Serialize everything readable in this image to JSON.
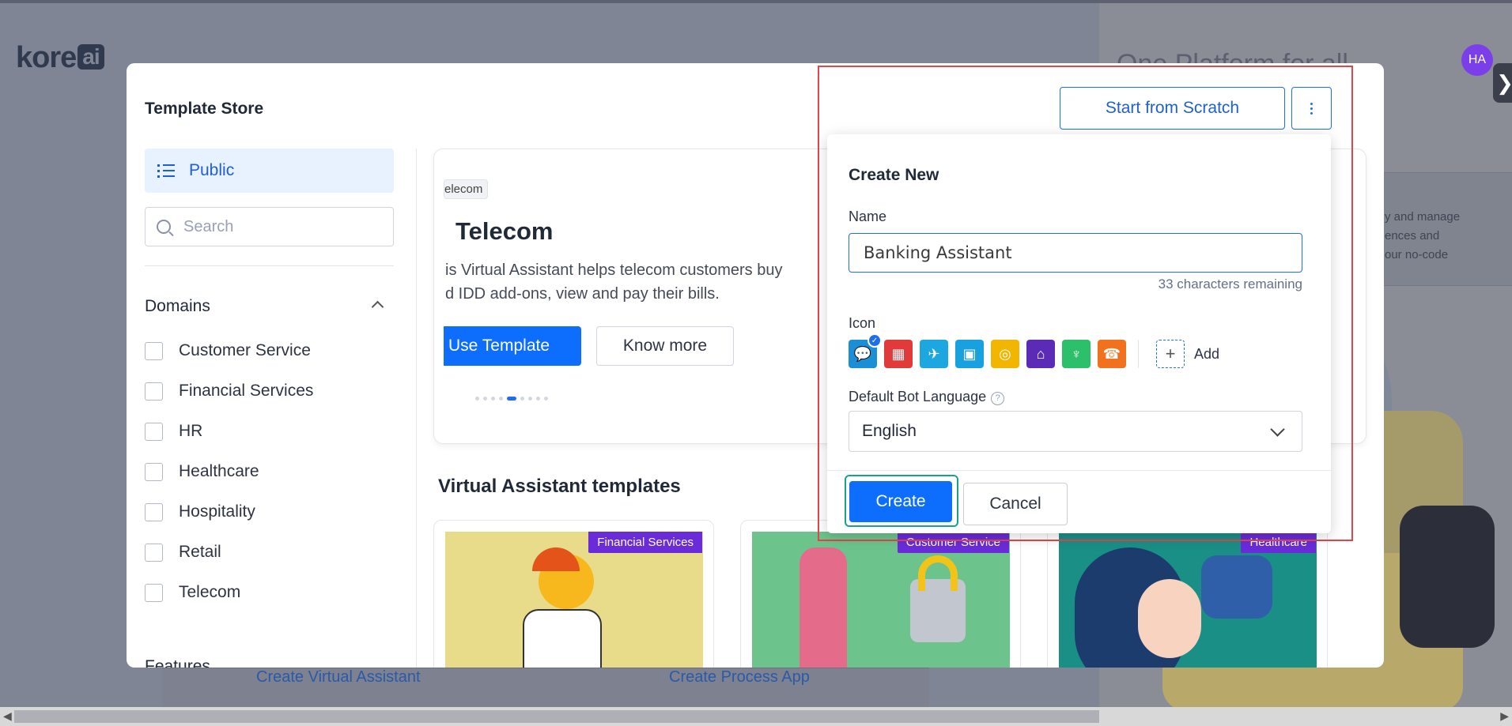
{
  "background": {
    "logo_text": "kore",
    "logo_suffix": "ai",
    "heading": "One Platform for all",
    "avatar_initials": "HA",
    "side_toggle_glyph": "❯",
    "card_lines": [
      "y and manage",
      "ences and",
      "our no-code"
    ],
    "bottom_links": [
      "Create Virtual Assistant",
      "Create Process App"
    ]
  },
  "modal": {
    "title": "Template Store",
    "public_label": "Public",
    "search_placeholder": "Search",
    "domains_title": "Domains",
    "domains": [
      "Customer Service",
      "Financial Services",
      "HR",
      "Healthcare",
      "Hospitality",
      "Retail",
      "Telecom"
    ],
    "features_title": "Features",
    "hero": {
      "tag": "elecom",
      "title": "Telecom",
      "desc_line1": "is Virtual Assistant helps telecom customers buy",
      "desc_line2": "d IDD add-ons, view and pay their bills.",
      "use_template": "Use Template",
      "know_more": "Know more",
      "active_dot": 4,
      "dot_count": 9
    },
    "section_title": "Virtual Assistant templates",
    "cards": [
      {
        "badge": "Financial Services",
        "color": "#e8db8a"
      },
      {
        "badge": "Customer Service",
        "color": "#6cc48c"
      },
      {
        "badge": "Healthcare",
        "color": "#1a8f86"
      }
    ]
  },
  "create_new": {
    "start_from_scratch": "Start from Scratch",
    "title": "Create New",
    "name_label": "Name",
    "name_value": "Banking Assistant",
    "remaining": "33 characters remaining",
    "icon_label": "Icon",
    "icons": [
      {
        "name": "chat-bot-icon",
        "color": "#1b8fd6",
        "glyph": "💬",
        "selected": true
      },
      {
        "name": "building-icon",
        "color": "#e03a3a",
        "glyph": "▦",
        "selected": false
      },
      {
        "name": "airplane-icon",
        "color": "#1ca7e0",
        "glyph": "✈",
        "selected": false
      },
      {
        "name": "shopping-bag-icon",
        "color": "#19a0de",
        "glyph": "▣",
        "selected": false
      },
      {
        "name": "coin-icon",
        "color": "#f2b600",
        "glyph": "◎",
        "selected": false
      },
      {
        "name": "bank-icon",
        "color": "#5b2bb8",
        "glyph": "⌂",
        "selected": false
      },
      {
        "name": "glass-icon",
        "color": "#2cc06a",
        "glyph": "♆",
        "selected": false
      },
      {
        "name": "telephone-icon",
        "color": "#f2711c",
        "glyph": "☎",
        "selected": false
      }
    ],
    "add_label": "Add",
    "language_label": "Default Bot Language",
    "language_value": "English",
    "create_label": "Create",
    "cancel_label": "Cancel"
  }
}
